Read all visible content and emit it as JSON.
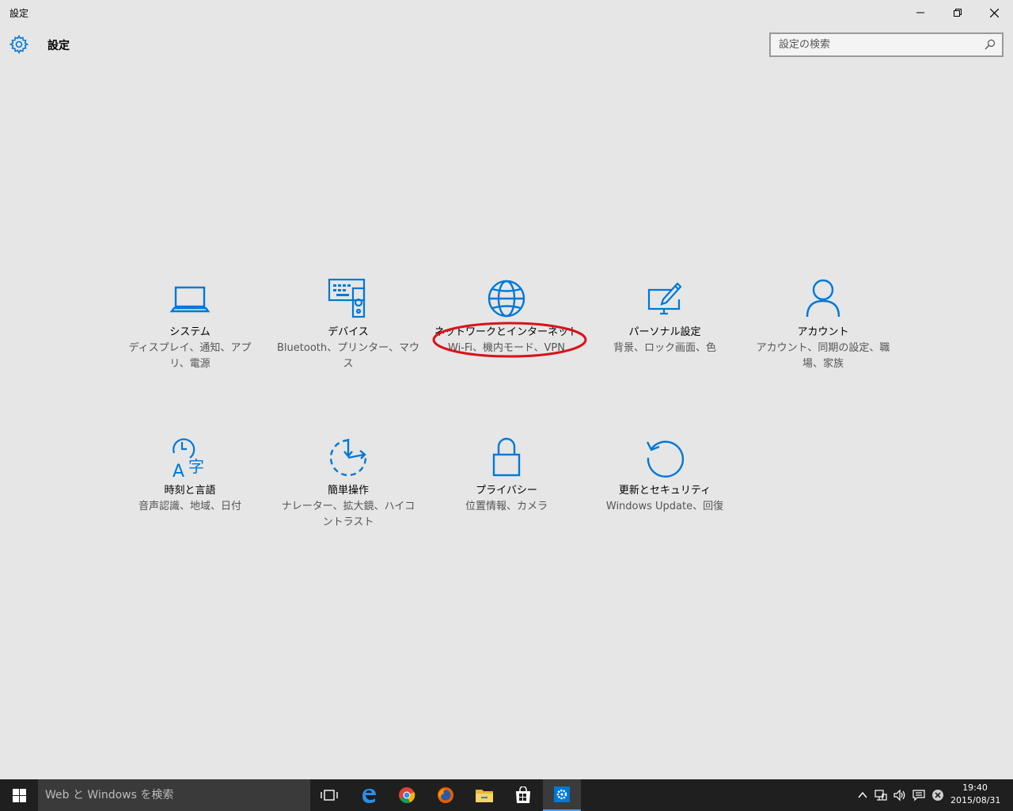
{
  "window": {
    "title": "設定"
  },
  "header": {
    "title": "設定"
  },
  "search": {
    "placeholder": "設定の検索"
  },
  "tiles": [
    {
      "name": "システム",
      "desc": "ディスプレイ、通知、アプリ、電源",
      "icon": "laptop-icon"
    },
    {
      "name": "デバイス",
      "desc": "Bluetooth、プリンター、マウス",
      "icon": "devices-icon"
    },
    {
      "name": "ネットワークとインターネット",
      "desc": "Wi-Fi、機内モード、VPN",
      "icon": "globe-icon"
    },
    {
      "name": "パーソナル設定",
      "desc": "背景、ロック画面、色",
      "icon": "personalization-icon"
    },
    {
      "name": "アカウント",
      "desc": "アカウント、同期の設定、職場、家族",
      "icon": "person-icon"
    },
    {
      "name": "時刻と言語",
      "desc": "音声認識、地域、日付",
      "icon": "time-language-icon"
    },
    {
      "name": "簡単操作",
      "desc": "ナレーター、拡大鏡、ハイコントラスト",
      "icon": "ease-of-access-icon"
    },
    {
      "name": "プライバシー",
      "desc": "位置情報、カメラ",
      "icon": "lock-icon"
    },
    {
      "name": "更新とセキュリティ",
      "desc": "Windows Update、回復",
      "icon": "update-icon"
    }
  ],
  "taskbar": {
    "search_placeholder": "Web と Windows を検索",
    "time": "19:40",
    "date": "2015/08/31"
  },
  "colors": {
    "accent": "#0078d7",
    "annotation": "#d9121b",
    "taskbar": "#1f1f1f"
  }
}
